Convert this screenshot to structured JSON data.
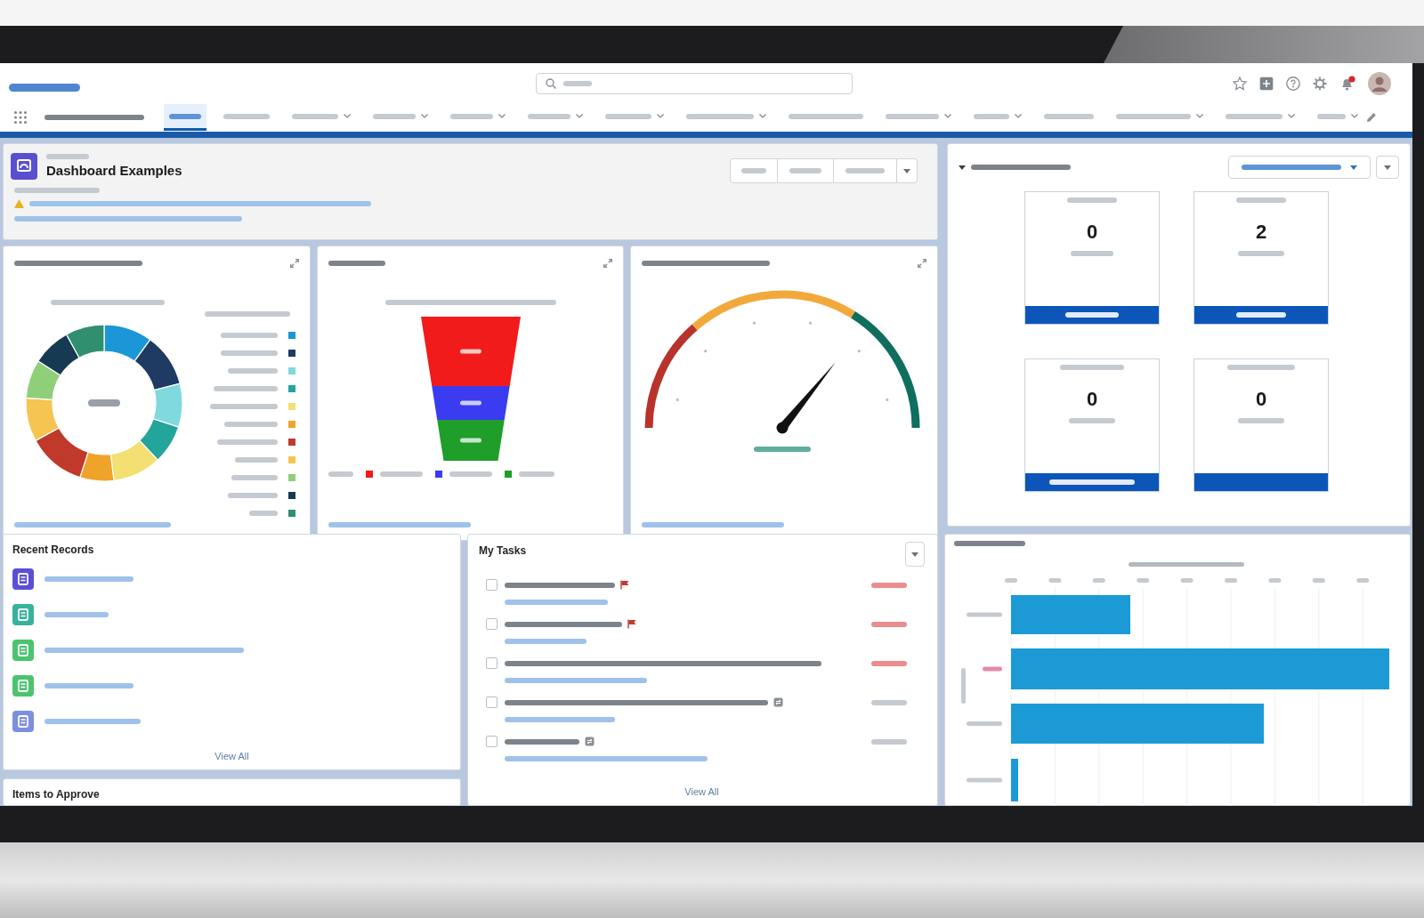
{
  "header": {
    "nav_tabs": [
      {
        "selected": true,
        "menu": false
      },
      {
        "selected": false,
        "menu": false
      },
      {
        "selected": false,
        "menu": true
      },
      {
        "selected": false,
        "menu": true
      },
      {
        "selected": false,
        "menu": true
      },
      {
        "selected": false,
        "menu": true
      },
      {
        "selected": false,
        "menu": true
      },
      {
        "selected": false,
        "menu": true
      },
      {
        "selected": false,
        "menu": false
      },
      {
        "selected": false,
        "menu": true
      },
      {
        "selected": false,
        "menu": true
      },
      {
        "selected": false,
        "menu": false
      },
      {
        "selected": false,
        "menu": true
      },
      {
        "selected": false,
        "menu": true
      },
      {
        "selected": false,
        "menu": true
      }
    ]
  },
  "dashboard_header": {
    "title": "Dashboard Examples"
  },
  "donut_card": {
    "legend": [
      {
        "color": "#1b96d6"
      },
      {
        "color": "#1f3b63"
      },
      {
        "color": "#7fd9de"
      },
      {
        "color": "#23a59b"
      },
      {
        "color": "#f3df72"
      },
      {
        "color": "#f0a32a"
      },
      {
        "color": "#c0392b"
      },
      {
        "color": "#f5c451"
      },
      {
        "color": "#8fcf7a"
      },
      {
        "color": "#163a52"
      },
      {
        "color": "#2f8f6f"
      }
    ]
  },
  "funnel_card": {
    "stages": [
      {
        "color": "#f21b1b"
      },
      {
        "color": "#3b3bf2"
      },
      {
        "color": "#1f9e2a"
      }
    ]
  },
  "goals_panel": {
    "tiles": [
      {
        "value": "0",
        "caption_visible": true
      },
      {
        "value": "2",
        "caption_visible": true
      },
      {
        "value": "0",
        "caption_visible": true
      },
      {
        "value": "0",
        "caption_visible": false
      }
    ]
  },
  "recent_records": {
    "title": "Recent Records",
    "records": [
      {
        "color": "#5b4fd6"
      },
      {
        "color": "#37b39b"
      },
      {
        "color": "#4cc46f"
      },
      {
        "color": "#4cc46f"
      },
      {
        "color": "#7c8fe0"
      }
    ],
    "link": "View All"
  },
  "items_to_approve": {
    "title": "Items to Approve"
  },
  "tasks": {
    "title": "My Tasks",
    "items": [
      {
        "kind": "flagged",
        "checked": false,
        "overdue": true
      },
      {
        "kind": "flagged",
        "checked": false,
        "overdue": true
      },
      {
        "kind": "plain",
        "checked": false,
        "overdue": true
      },
      {
        "kind": "recurring",
        "checked": false,
        "overdue": false
      },
      {
        "kind": "recurring",
        "checked": false,
        "overdue": false
      }
    ],
    "link": "View All"
  }
}
